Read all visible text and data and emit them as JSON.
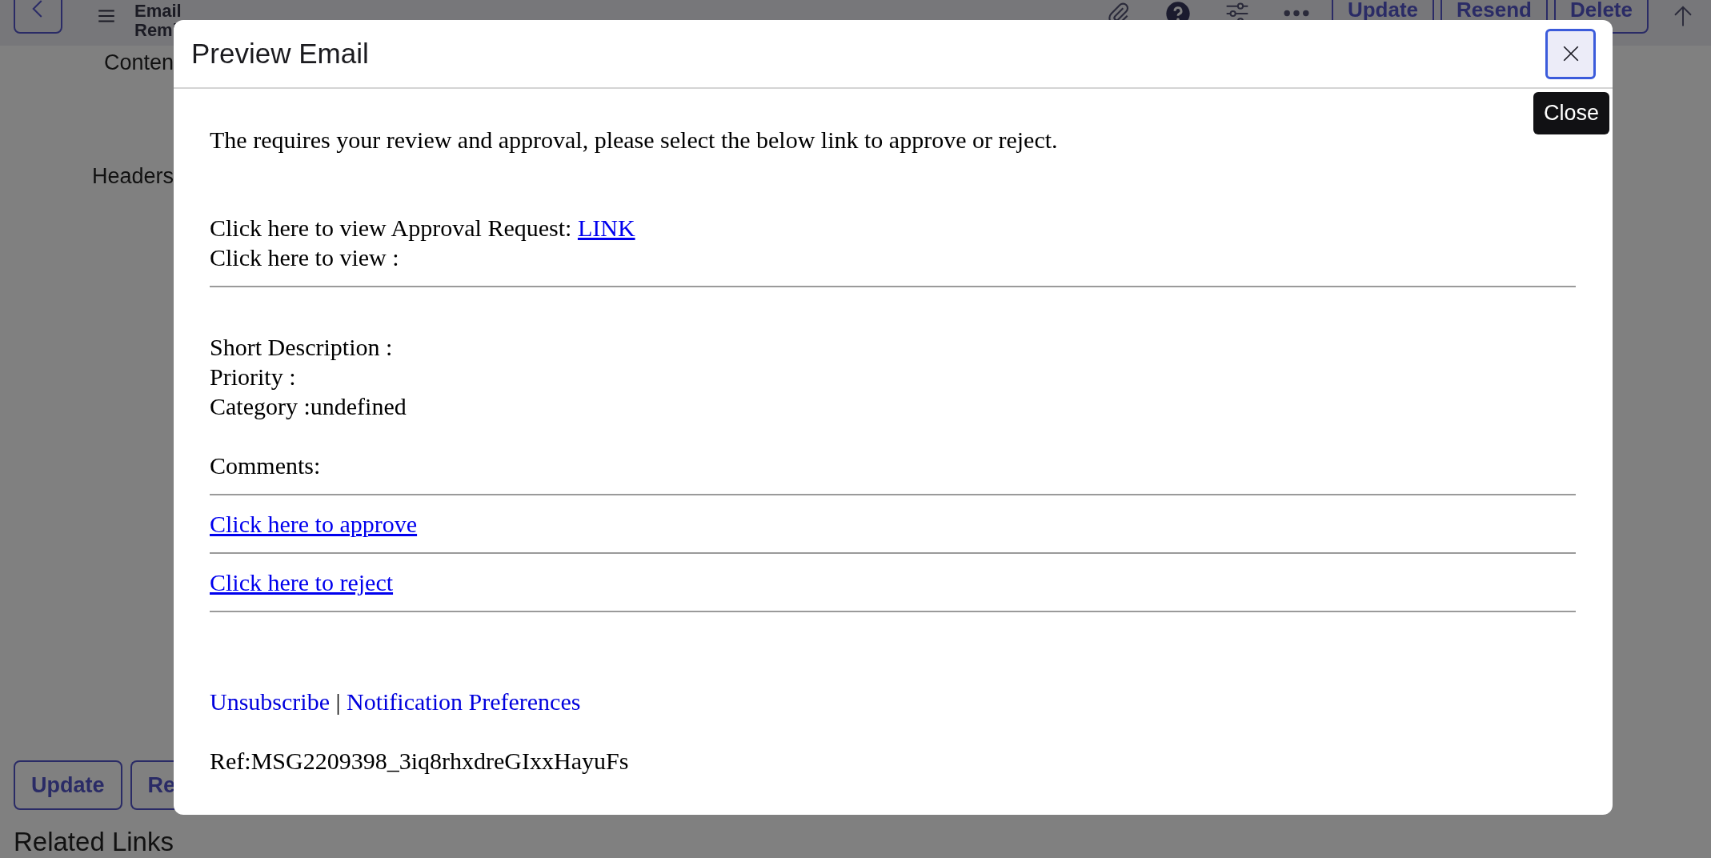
{
  "header": {
    "title_lines": [
      "Email",
      "Remi"
    ],
    "buttons": [
      "Update",
      "Resend",
      "Delete"
    ]
  },
  "form": {
    "labels": [
      "Conten",
      "Headers"
    ]
  },
  "bottom_buttons": [
    "Update",
    "Re"
  ],
  "related_links": {
    "title": "Related Links"
  },
  "modal": {
    "title": "Preview Email",
    "close_tooltip": "Close",
    "blocks": [
      {
        "kind": "intro",
        "lines": [
          [
            {
              "kind": "text",
              "text": "The requires your review and approval, please select the below link to approve or reject."
            }
          ]
        ]
      },
      {
        "kind": "paragraph",
        "lines": [
          [
            {
              "kind": "text",
              "text": "Click here to view Approval Request: "
            },
            {
              "kind": "link",
              "text": "LINK"
            }
          ],
          [
            {
              "kind": "text",
              "text": "Click here to view :"
            }
          ]
        ]
      },
      {
        "kind": "rule"
      },
      {
        "kind": "paragraph",
        "lines": [
          [
            {
              "kind": "text",
              "text": "Short Description :"
            }
          ],
          [
            {
              "kind": "text",
              "text": "Priority :"
            }
          ],
          [
            {
              "kind": "text",
              "text": "Category :undefined"
            }
          ]
        ]
      },
      {
        "kind": "paragraph",
        "lines": [
          [
            {
              "kind": "text",
              "text": "Comments:"
            }
          ]
        ]
      },
      {
        "kind": "rule"
      },
      {
        "kind": "link",
        "lines": [
          [
            {
              "kind": "link",
              "text": "Click here to approve"
            }
          ]
        ]
      },
      {
        "kind": "rule"
      },
      {
        "kind": "link",
        "lines": [
          [
            {
              "kind": "link",
              "text": "Click here to reject"
            }
          ]
        ]
      },
      {
        "kind": "rule"
      },
      {
        "kind": "footer",
        "lines": [
          [
            {
              "kind": "plain-link",
              "text": "Unsubscribe"
            },
            {
              "kind": "text",
              "text": " | "
            },
            {
              "kind": "plain-link",
              "text": "Notification Preferences"
            }
          ]
        ]
      },
      {
        "kind": "paragraph",
        "lines": [
          [
            {
              "kind": "text",
              "text": "Ref:MSG2209398_3iq8rhxdreGIxxHayuFs"
            }
          ]
        ]
      }
    ]
  }
}
